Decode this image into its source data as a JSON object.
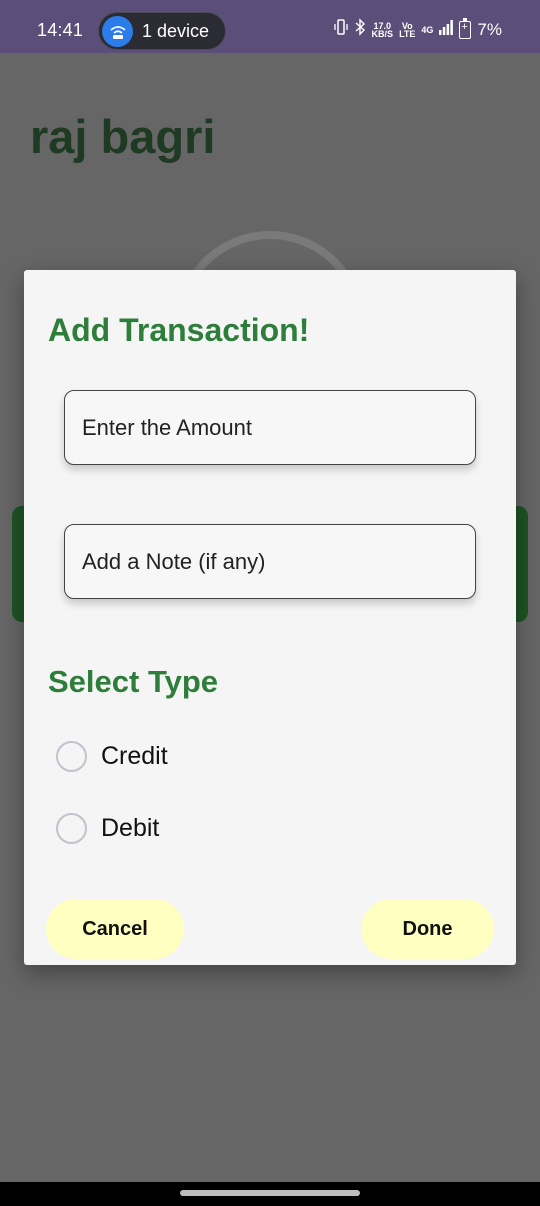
{
  "status_bar": {
    "time": "14:41",
    "device_pill_label": "1 device",
    "net_speed_value": "17.0",
    "net_speed_unit": "KB/S",
    "volte_top": "Vo",
    "volte_bottom": "LTE",
    "network_type": "4G",
    "battery_percent": "7%"
  },
  "background": {
    "user_name": "raj bagri",
    "accent_color": "#1e5424"
  },
  "dialog": {
    "title": "Add Transaction!",
    "amount_placeholder": "Enter the Amount",
    "note_placeholder": "Add a Note (if any)",
    "type_section_title": "Select Type",
    "radio_options": [
      {
        "label": "Credit",
        "selected": false
      },
      {
        "label": "Debit",
        "selected": false
      }
    ],
    "cancel_label": "Cancel",
    "done_label": "Done",
    "title_color": "#2e7d3a",
    "button_color": "#ffffc2"
  }
}
